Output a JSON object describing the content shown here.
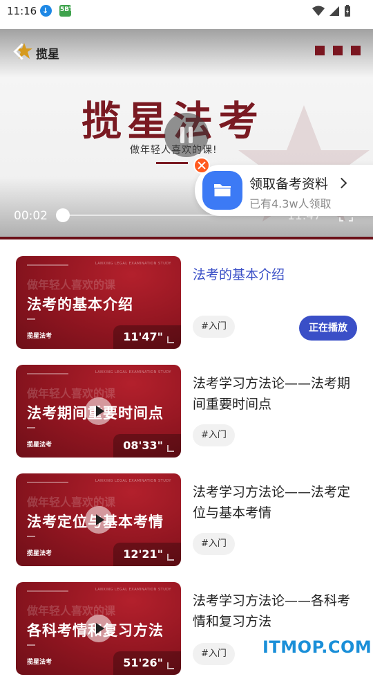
{
  "status_bar": {
    "time": "11:16",
    "app_badge": "5BT"
  },
  "player": {
    "brand_name": "揽星",
    "course_title": "揽星法考",
    "course_subtitle": "做年轻人喜欢的课!",
    "current_time": "00:02",
    "duration": "11:47",
    "progress_fraction": 0.0
  },
  "promo": {
    "title": "领取备考资料",
    "subtitle": "已有4.3w人领取"
  },
  "lessons": [
    {
      "thumb_ghost": "做年轻人喜欢的课",
      "thumb_title": "法考的基本介绍",
      "thumb_brand": "揽星法考",
      "duration": "11'47\"",
      "title": "法考的基本介绍",
      "tag": "#入门",
      "status": "正在播放"
    },
    {
      "thumb_ghost": "做年轻人喜欢的课",
      "thumb_title": "法考期间重要时间点",
      "thumb_brand": "揽星法考",
      "duration": "08'33\"",
      "title": "法考学习方法论——法考期间重要时间点",
      "tag": "#入门"
    },
    {
      "thumb_ghost": "做年轻人喜欢的课",
      "thumb_title": "法考定位与基本考情",
      "thumb_brand": "揽星法考",
      "duration": "12'21\"",
      "title": "法考学习方法论——法考定位与基本考情",
      "tag": "#入门"
    },
    {
      "thumb_ghost": "做年轻人喜欢的课",
      "thumb_title": "各科考情和复习方法",
      "thumb_brand": "揽星法考",
      "duration": "51'26\"",
      "title": "法考学习方法论——各科考情和复习方法",
      "tag": "#入门"
    }
  ],
  "thumb_caption": "LANXING LEGAL EXAMINATION STUDY",
  "watermark": "ITMOP.COM",
  "colors": {
    "accent": "#3a4fc7",
    "brand_red": "#7a1a22",
    "promo_blue": "#3c7af5",
    "close_orange": "#ff5a1f"
  }
}
